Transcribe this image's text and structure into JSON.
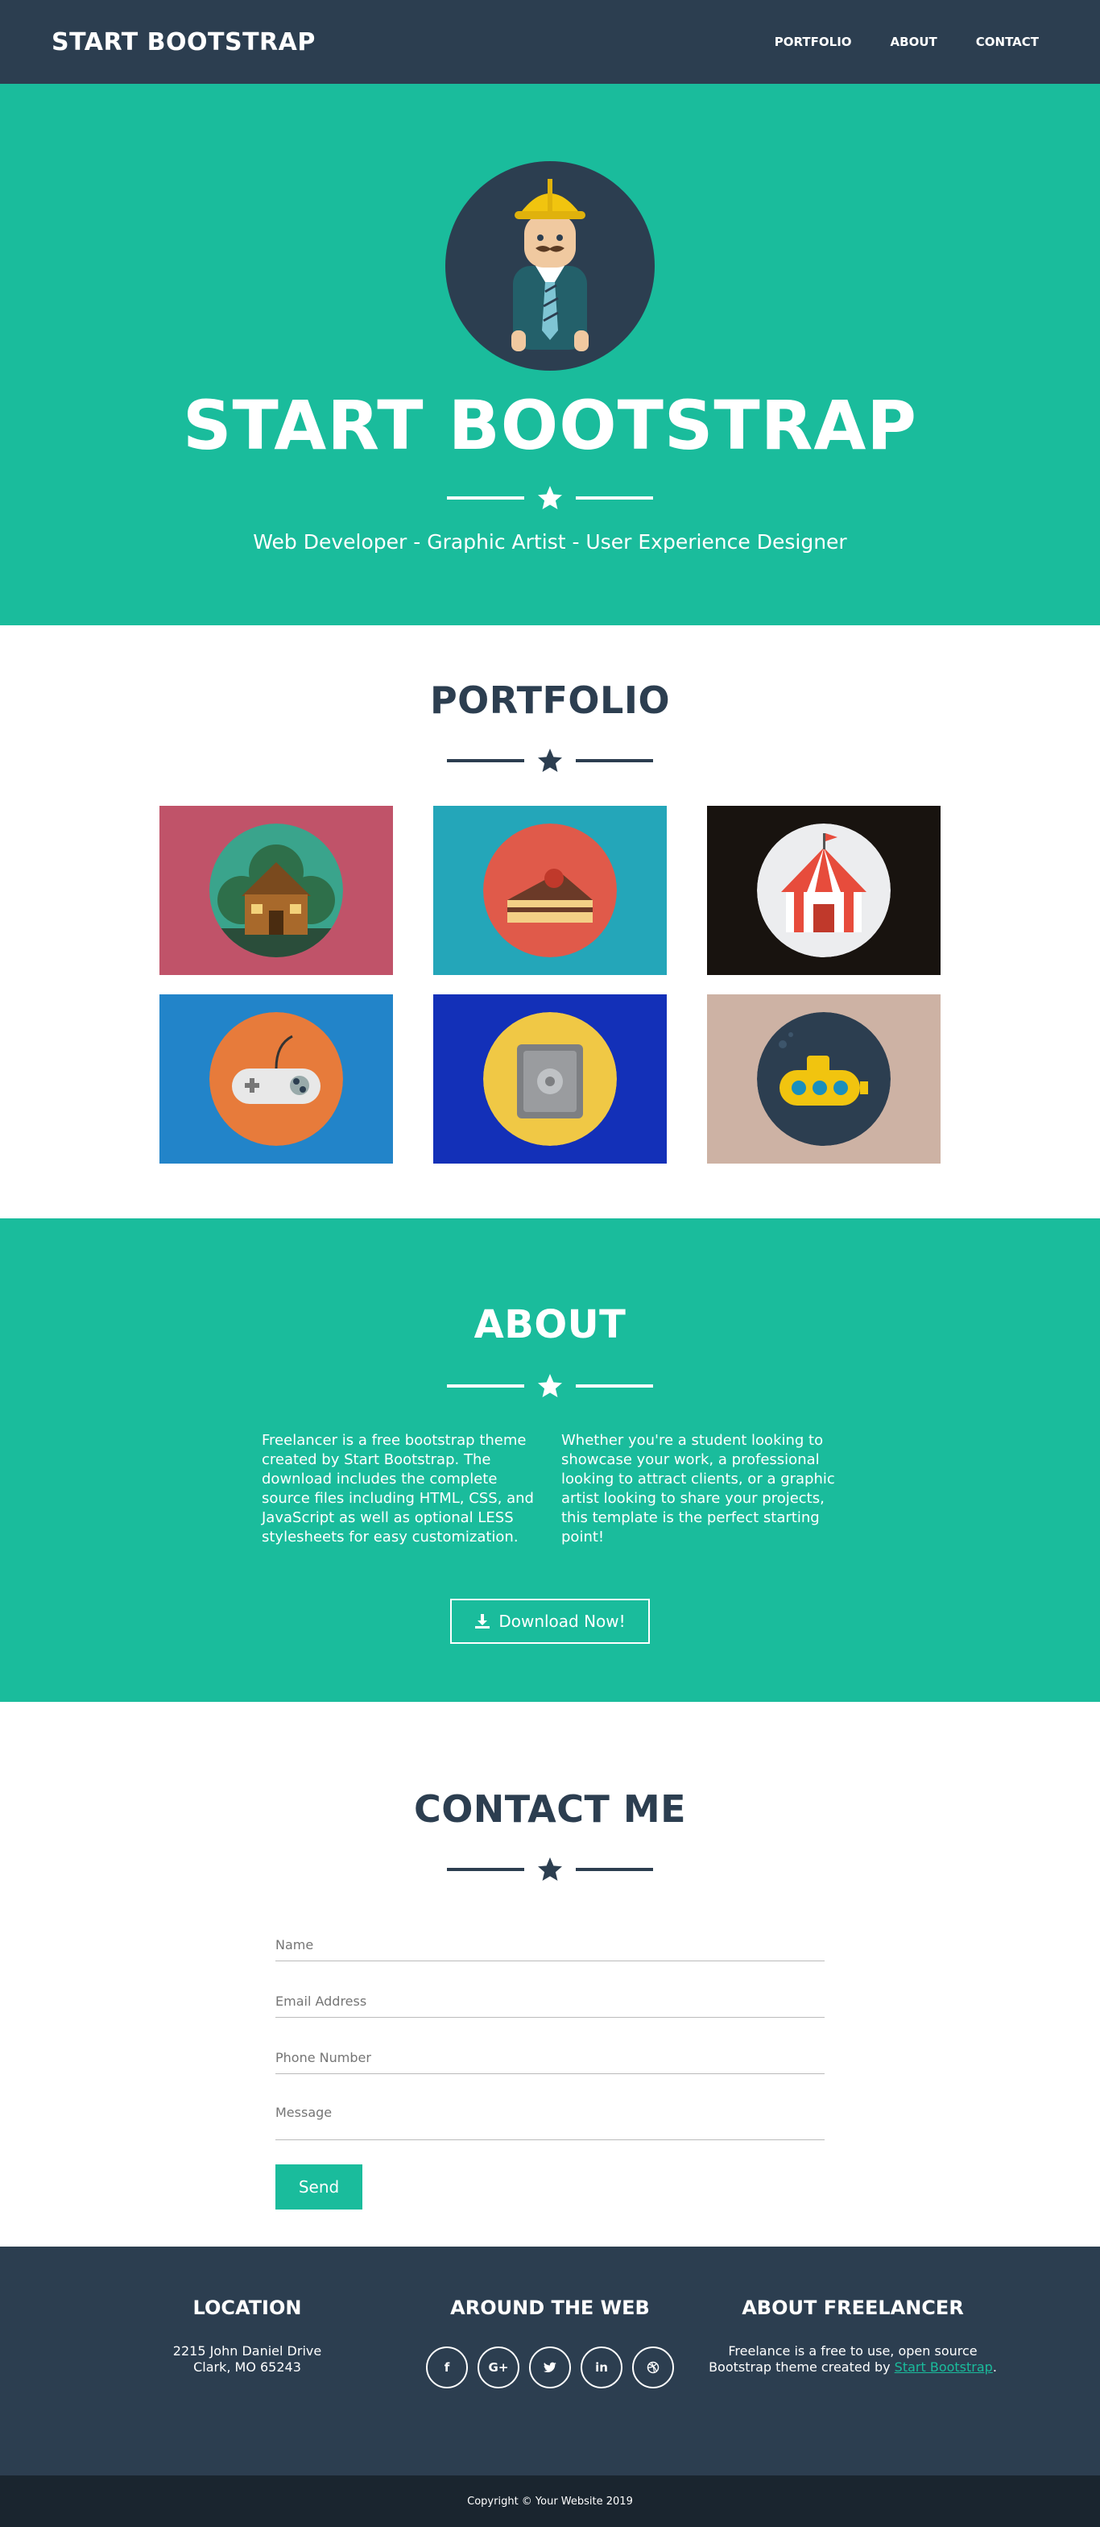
{
  "nav": {
    "brand": "START BOOTSTRAP",
    "links": [
      "PORTFOLIO",
      "ABOUT",
      "CONTACT"
    ]
  },
  "masthead": {
    "title": "START BOOTSTRAP",
    "subtitle": "Web Developer - Graphic Artist - User Experience Designer",
    "avatar_icon": "construction-worker-avatar"
  },
  "portfolio": {
    "title": "PORTFOLIO",
    "items": [
      {
        "icon": "cabin-icon",
        "bg": "#c05369"
      },
      {
        "icon": "cake-icon",
        "bg": "#24a6b9"
      },
      {
        "icon": "circus-tent-icon",
        "bg": "#18130f"
      },
      {
        "icon": "game-controller-icon",
        "bg": "#2284c9"
      },
      {
        "icon": "safe-icon",
        "bg": "#1330b8"
      },
      {
        "icon": "submarine-icon",
        "bg": "#cdb2a4"
      }
    ]
  },
  "about": {
    "title": "ABOUT",
    "col1": "Freelancer is a free bootstrap theme created by Start Bootstrap. The download includes the complete source files including HTML, CSS, and JavaScript as well as optional LESS stylesheets for easy customization.",
    "col2": "Whether you're a student looking to showcase your work, a professional looking to attract clients, or a graphic artist looking to share your projects, this template is the perfect starting point!",
    "download_label": "Download Now!"
  },
  "contact": {
    "title": "CONTACT ME",
    "fields": {
      "name": "Name",
      "email": "Email Address",
      "phone": "Phone Number",
      "message": "Message"
    },
    "send_label": "Send"
  },
  "footer": {
    "location_title": "LOCATION",
    "address_line1": "2215 John Daniel Drive",
    "address_line2": "Clark, MO 65243",
    "web_title": "AROUND THE WEB",
    "socials": [
      "f",
      "G+",
      "t",
      "in",
      "dribbble"
    ],
    "about_title": "ABOUT FREELANCER",
    "about_text": "Freelance is a free to use, open source Bootstrap theme created by",
    "about_link": "Start Bootstrap",
    "about_end": ".",
    "copyright": "Copyright © Your Website 2019"
  },
  "colors": {
    "primary": "#1abc9c",
    "dark": "#2c3e50",
    "darker": "#1a252f"
  }
}
